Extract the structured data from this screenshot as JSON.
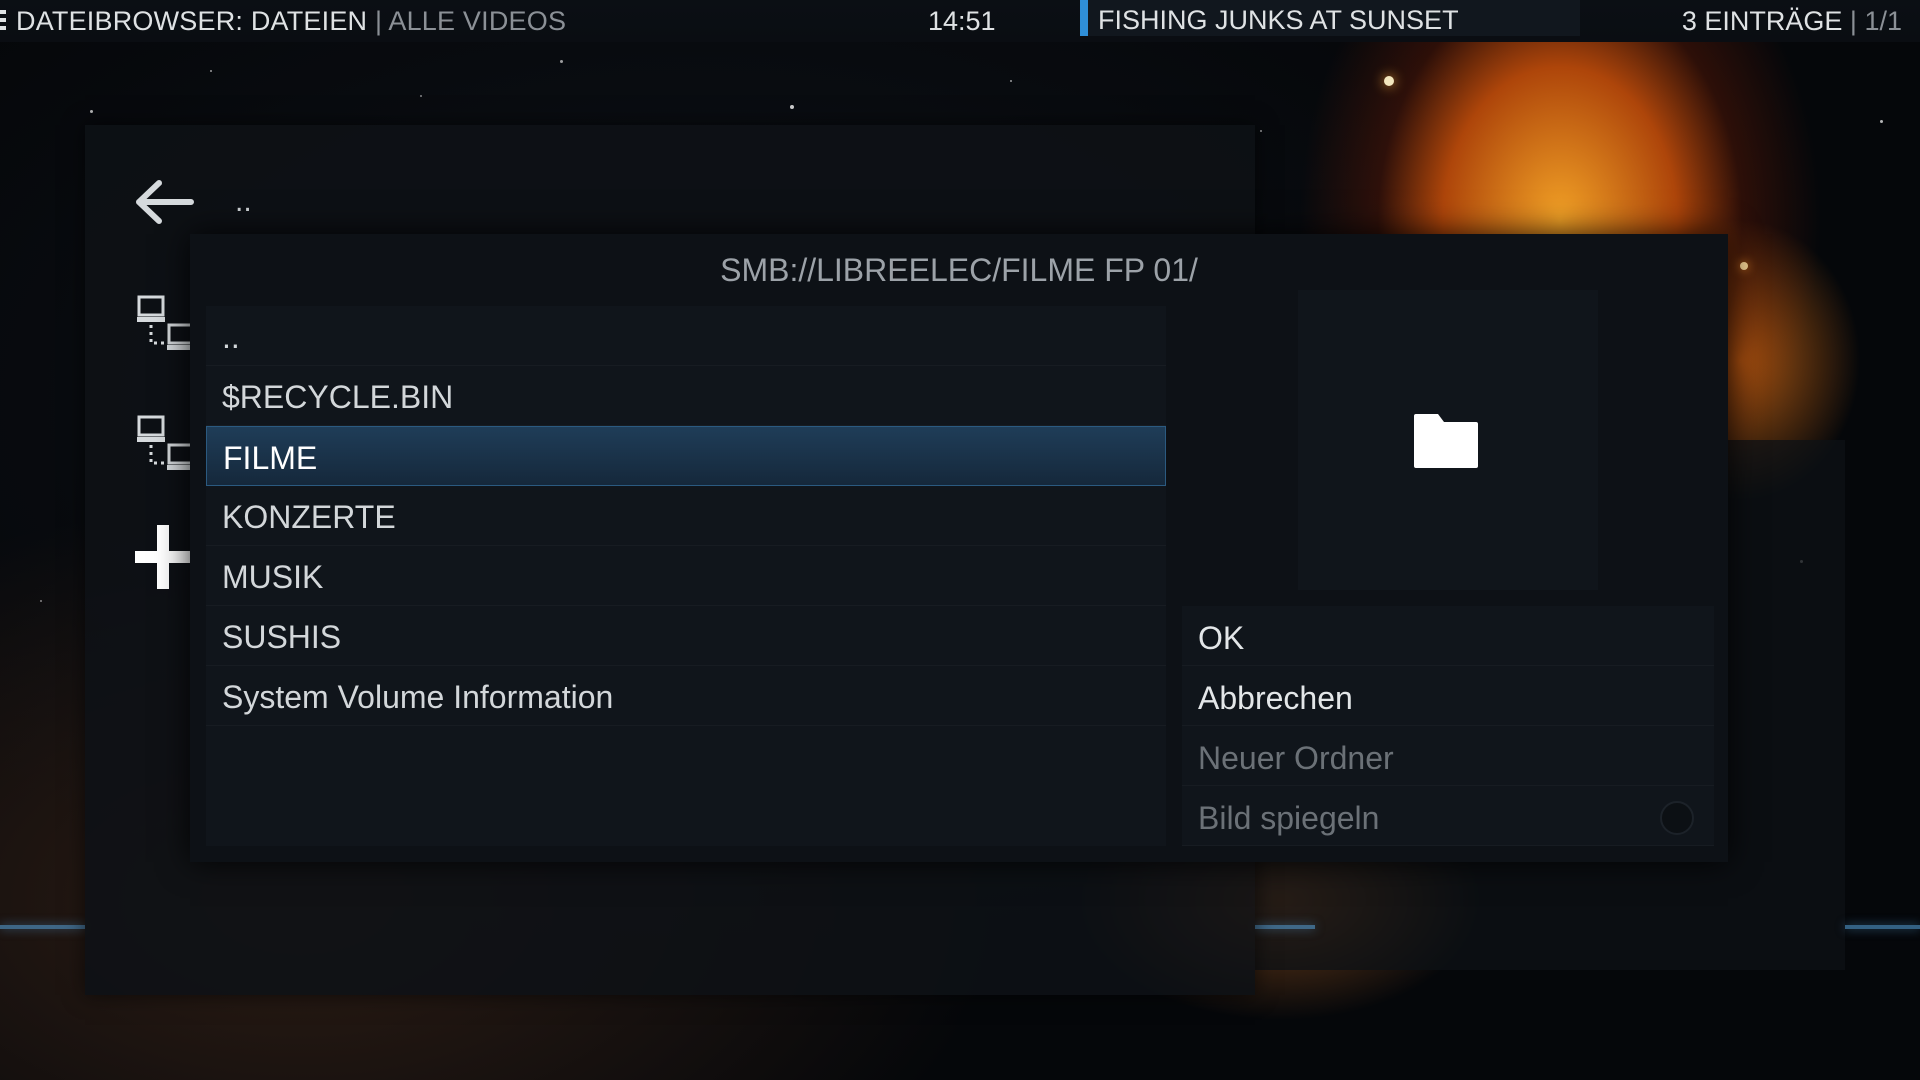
{
  "topbar": {
    "section": "DATEIBROWSER: DATEIEN",
    "separator": "|",
    "subsection": "ALLE VIDEOS",
    "clock": "14:51",
    "now_playing": "FISHING JUNKS AT SUNSET",
    "count": "3 EINTRÄGE",
    "page": "1/1"
  },
  "sidebar": {
    "back_label": "..",
    "icons": [
      "back-arrow-icon",
      "network-icon",
      "network-icon",
      "plus-icon"
    ]
  },
  "dialog": {
    "title": "SMB://LIBREELEC/FILME FP 01/",
    "items": [
      {
        "label": ".."
      },
      {
        "label": "$RECYCLE.BIN"
      },
      {
        "label": "FILME"
      },
      {
        "label": "KONZERTE"
      },
      {
        "label": "MUSIK"
      },
      {
        "label": "SUSHIS"
      },
      {
        "label": "System Volume Information"
      }
    ],
    "selected_index": 2,
    "thumbnail_icon": "folder-icon",
    "buttons": {
      "ok": "OK",
      "cancel": "Abbrechen",
      "new_folder": "Neuer Ordner",
      "flip_image": "Bild spiegeln"
    },
    "flip_image_enabled": false
  },
  "colors": {
    "accent": "#2f8fd8",
    "selected_row": "#1f3d58",
    "dialog_bg": "#0d1116",
    "disabled_text": "#6b7177"
  }
}
